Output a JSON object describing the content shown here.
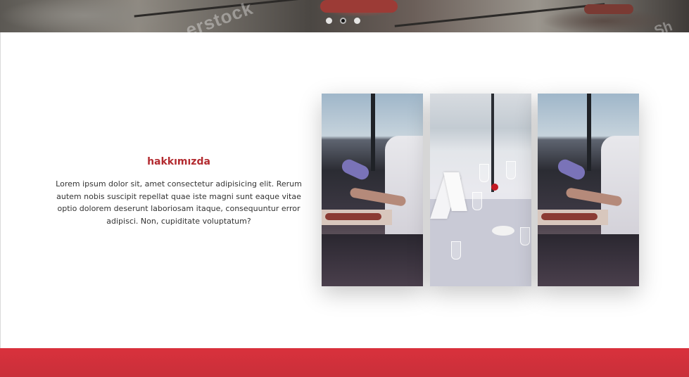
{
  "hero": {
    "watermark": "erstock",
    "watermark_right": "Sh",
    "slider_dots": [
      {
        "active": false
      },
      {
        "active": true
      },
      {
        "active": false
      }
    ]
  },
  "about": {
    "title": "hakkımızda",
    "body": "Lorem ipsum dolor sit, amet consectetur adipisicing elit. Rerum autem nobis suscipit repellat quae iste magni sunt eaque vitae optio dolorem deserunt laboriosam itaque, consequuntur error adipisci. Non, cupiditate voluptatum?"
  },
  "colors": {
    "accent": "#b32b30",
    "footer_gradient_from": "#d9313c",
    "footer_gradient_to": "#c9303a"
  }
}
